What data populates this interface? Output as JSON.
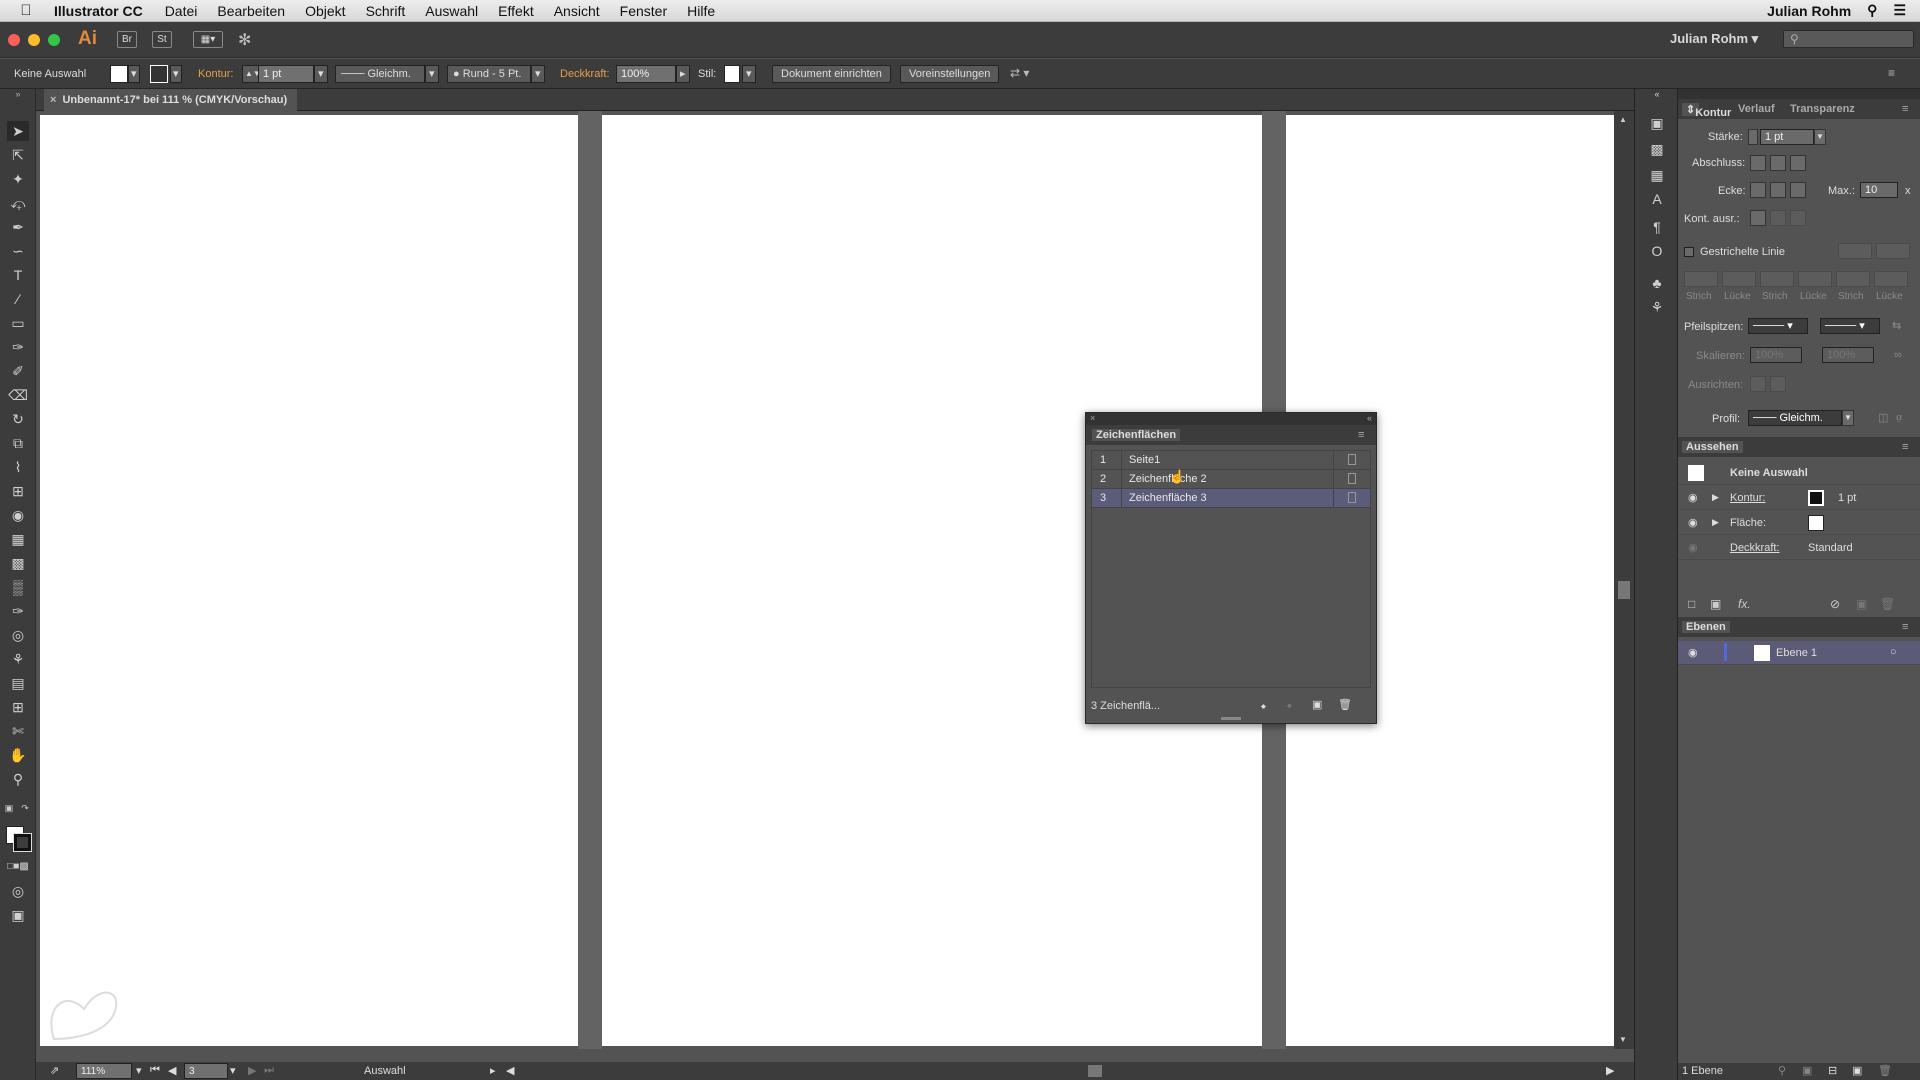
{
  "menubar": {
    "app_name": "Illustrator CC",
    "items": [
      "Datei",
      "Bearbeiten",
      "Objekt",
      "Schrift",
      "Auswahl",
      "Effekt",
      "Ansicht",
      "Fenster",
      "Hilfe"
    ],
    "user": "Julian Rohm"
  },
  "appbar": {
    "logo": "Ai",
    "bridge": "Br",
    "stock": "St",
    "workspace_user": "Julian Rohm",
    "colors": {
      "close": "#fc5f57",
      "minimize": "#fdbc2e",
      "zoom": "#33c748"
    }
  },
  "controlbar": {
    "selection": "Keine Auswahl",
    "kontur_label": "Kontur:",
    "kontur_value": "1 pt",
    "stroke_style": "Gleichm.",
    "brush": "Rund - 5 Pt.",
    "deckkraft_label": "Deckkraft:",
    "deckkraft_value": "100%",
    "stil_label": "Stil:",
    "btn_document": "Dokument einrichten",
    "btn_preferences": "Voreinstellungen"
  },
  "document": {
    "tab_title": "Unbenannt-17* bei 111 % (CMYK/Vorschau)"
  },
  "statusbar": {
    "zoom": "111%",
    "artboard_nav": "3",
    "tool_name": "Auswahl"
  },
  "artboards_panel": {
    "title": "Zeichenflächen",
    "rows": [
      {
        "num": "1",
        "name": "Seite1",
        "selected": false
      },
      {
        "num": "2",
        "name": "Zeichenfläche 2",
        "selected": false
      },
      {
        "num": "3",
        "name": "Zeichenfläche 3",
        "selected": true
      }
    ],
    "footer_count": "3 Zeichenflä..."
  },
  "stroke_panel": {
    "tabs": [
      "Kontur",
      "Verlauf",
      "Transparenz"
    ],
    "staerke_label": "Stärke:",
    "staerke_value": "1 pt",
    "abschluss_label": "Abschluss:",
    "ecke_label": "Ecke:",
    "max_label": "Max.:",
    "max_value": "10",
    "max_unit": "x",
    "kont_label": "Kont. ausr.:",
    "dashed_label": "Gestrichelte Linie",
    "dash_labels": [
      "Strich",
      "Lücke",
      "Strich",
      "Lücke",
      "Strich",
      "Lücke"
    ],
    "pfeilspitzen_label": "Pfeilspitzen:",
    "skalieren_label": "Skalieren:",
    "skalieren_value_1": "100%",
    "skalieren_value_2": "100%",
    "ausrichten_label": "Ausrichten:",
    "profil_label": "Profil:",
    "profil_value": "Gleichm."
  },
  "appearance_panel": {
    "title": "Aussehen",
    "selection": "Keine Auswahl",
    "kontur_label": "Kontur:",
    "kontur_value": "1 pt",
    "flaeche_label": "Fläche:",
    "deckkraft_label": "Deckkraft:",
    "deckkraft_value": "Standard"
  },
  "layers_panel": {
    "title": "Ebenen",
    "layer_name": "Ebene 1",
    "footer_count": "1 Ebene",
    "accent": "#4f6bd8"
  }
}
